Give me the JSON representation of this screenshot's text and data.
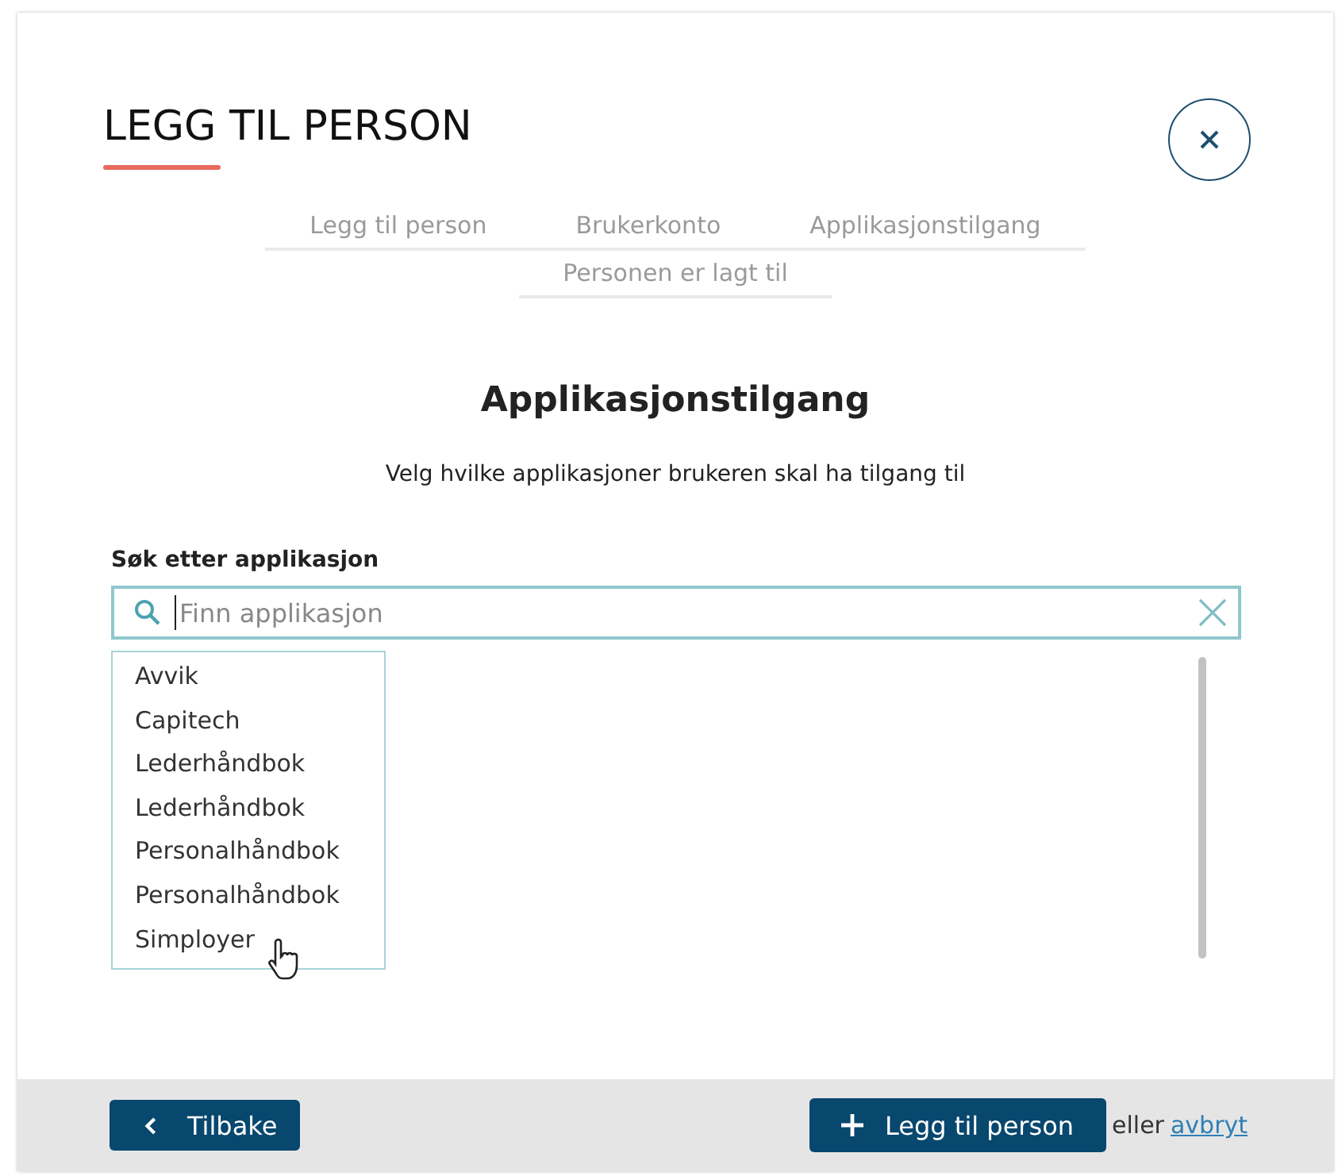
{
  "dialog": {
    "title": "LEGG TIL PERSON"
  },
  "steps": [
    "Legg til person",
    "Brukerkonto",
    "Applikasjonstilgang",
    "Personen er lagt til"
  ],
  "section": {
    "heading": "Applikasjonstilgang",
    "description": "Velg hvilke applikasjoner brukeren skal ha tilgang til"
  },
  "search": {
    "label": "Søk etter applikasjon",
    "placeholder": "Finn applikasjon"
  },
  "results": [
    "Avvik",
    "Capitech",
    "Lederhåndbok",
    "Lederhåndbok",
    "Personalhåndbok",
    "Personalhåndbok",
    "Simployer"
  ],
  "footer": {
    "back_button": "Tilbake",
    "add_button": "Legg til person",
    "or_text": "eller",
    "cancel_link": "avbryt"
  }
}
